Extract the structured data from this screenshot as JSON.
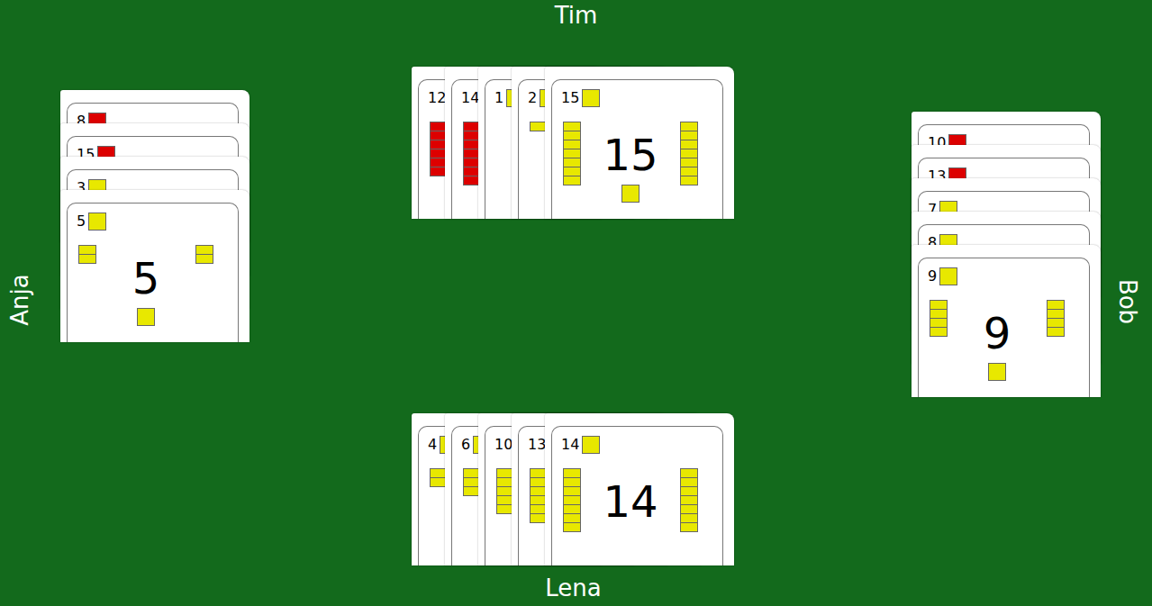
{
  "players": [
    {
      "name": "Tim",
      "cards": [
        {
          "value": "12",
          "color": "#dd0000"
        },
        {
          "value": "14",
          "color": "#dd0000"
        },
        {
          "value": "1",
          "color": "#e8e800"
        },
        {
          "value": "2",
          "color": "#e8e800"
        },
        {
          "value": "15",
          "color": "#e8e800"
        }
      ]
    },
    {
      "name": "Anja",
      "cards": [
        {
          "value": "8",
          "color": "#dd0000"
        },
        {
          "value": "15",
          "color": "#dd0000"
        },
        {
          "value": "3",
          "color": "#e8e800"
        },
        {
          "value": "5",
          "color": "#e8e800"
        }
      ]
    },
    {
      "name": "Bob",
      "cards": [
        {
          "value": "10",
          "color": "#dd0000"
        },
        {
          "value": "13",
          "color": "#dd0000"
        },
        {
          "value": "7",
          "color": "#e8e800"
        },
        {
          "value": "8",
          "color": "#e8e800"
        },
        {
          "value": "9",
          "color": "#e8e800"
        }
      ]
    },
    {
      "name": "Lena",
      "cards": [
        {
          "value": "4",
          "color": "#e8e800"
        },
        {
          "value": "6",
          "color": "#e8e800"
        },
        {
          "value": "10",
          "color": "#e8e800"
        },
        {
          "value": "13",
          "color": "#e8e800"
        },
        {
          "value": "14",
          "color": "#e8e800"
        }
      ]
    }
  ]
}
